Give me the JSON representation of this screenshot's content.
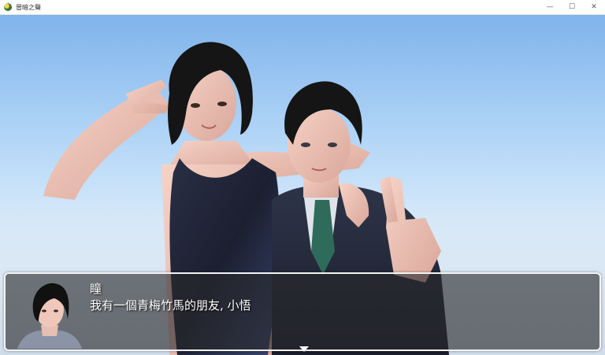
{
  "window": {
    "title": "晉暗之聲",
    "minimize_glyph": "—",
    "maximize_glyph": "☐",
    "close_glyph": "✕",
    "icon": "app-icon"
  },
  "dialogue": {
    "speaker": "瞳",
    "message": "我有一個青梅竹馬的朋友, 小悟",
    "continue_icon": "triangle-down-icon"
  }
}
